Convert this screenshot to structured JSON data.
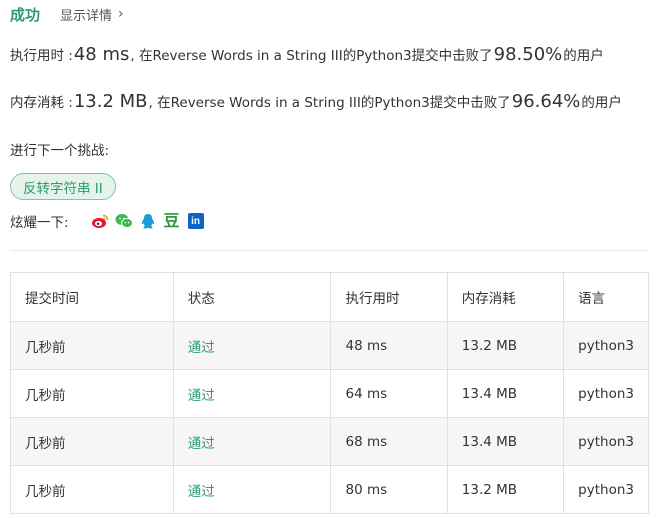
{
  "header": {
    "status": "成功",
    "details_link": "显示详情"
  },
  "runtime": {
    "label": "执行用时 : ",
    "value": "48 ms",
    "mid_text": ", 在Reverse Words in a String III的Python3提交中击败了",
    "percent": "98.50%",
    "suffix": " 的用户"
  },
  "memory": {
    "label": "内存消耗 : ",
    "value": "13.2 MB",
    "mid_text": ", 在Reverse Words in a String III的Python3提交中击败了",
    "percent": "96.64%",
    "suffix": " 的用户"
  },
  "next_challenge": {
    "label": "进行下一个挑战:",
    "button": "反转字符串 II"
  },
  "share": {
    "label": "炫耀一下:",
    "icons": [
      "weibo-icon",
      "wechat-icon",
      "qq-icon",
      "douban-icon",
      "linkedin-icon"
    ],
    "douban_glyph": "豆",
    "linkedin_glyph": "in"
  },
  "colors": {
    "accent_green": "#2e9c6e",
    "weibo_red": "#e6162d",
    "wechat_green": "#3eb94e",
    "qq_blue": "#1d9bd8",
    "douban_green": "#2e963d",
    "linkedin_blue": "#0a66c2"
  },
  "table": {
    "headers": [
      "提交时间",
      "状态",
      "执行用时",
      "内存消耗",
      "语言"
    ],
    "rows": [
      [
        "几秒前",
        "通过",
        "48 ms",
        "13.2 MB",
        "python3"
      ],
      [
        "几秒前",
        "通过",
        "64 ms",
        "13.4 MB",
        "python3"
      ],
      [
        "几秒前",
        "通过",
        "68 ms",
        "13.4 MB",
        "python3"
      ],
      [
        "几秒前",
        "通过",
        "80 ms",
        "13.2 MB",
        "python3"
      ]
    ]
  }
}
